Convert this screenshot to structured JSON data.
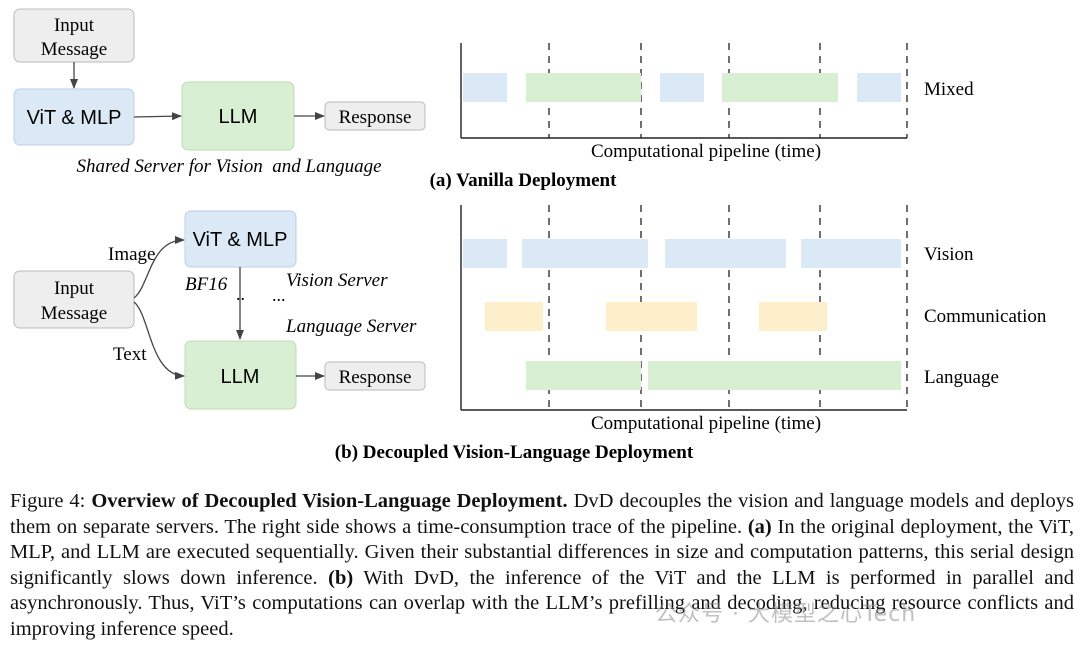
{
  "colors": {
    "vision": "#dbe9f6",
    "language": "#d9efd3",
    "communication": "#fcefc9",
    "neutral_box": "#eeeeee",
    "stroke": "#333333"
  },
  "vanilla": {
    "input_line1": "Input",
    "input_line2": "Message",
    "vit_label": "ViT & MLP",
    "llm_label": "LLM",
    "response_label": "Response",
    "server_caption": "Shared Server for Vision  and Language",
    "subtitle": "(a) Vanilla Deployment",
    "axis_label": "Computational pipeline (time)",
    "row_label": "Mixed"
  },
  "decoupled": {
    "input_line1": "Input",
    "input_line2": "Message",
    "image_label": "Image",
    "text_label": "Text",
    "vit_label": "ViT & MLP",
    "llm_label": "LLM",
    "response_label": "Response",
    "bf16_label": "BF16",
    "vision_server_label": "Vision Server",
    "language_server_label": "Language Server",
    "dots1": "..",
    "dots2": "...",
    "subtitle": "(b) Decoupled Vision-Language Deployment",
    "axis_label": "Computational pipeline (time)",
    "row_vision": "Vision",
    "row_comm": "Communication",
    "row_language": "Language"
  },
  "caption": {
    "figure_label": "Figure 4:",
    "bold_title": "Overview of Decoupled Vision-Language Deployment.",
    "text1": " DvD decouples the vision and language models and deploys them on separate servers. The right side shows a time-consumption trace of the pipeline. ",
    "a_label": "(a)",
    "text2": " In the original deployment, the ViT, MLP, and LLM are executed sequentially.  Given their substantial differences in size and computation patterns, this serial design significantly slows down inference. ",
    "b_label": "(b)",
    "text3": " With DvD, the inference of the ViT and the LLM is performed in parallel and asynchronously. Thus, ViT’s computations can overlap with the LLM’s prefilling and decoding, reducing resource conflicts and improving inference speed."
  },
  "watermark": "公众号 · 大模型之心Tech"
}
